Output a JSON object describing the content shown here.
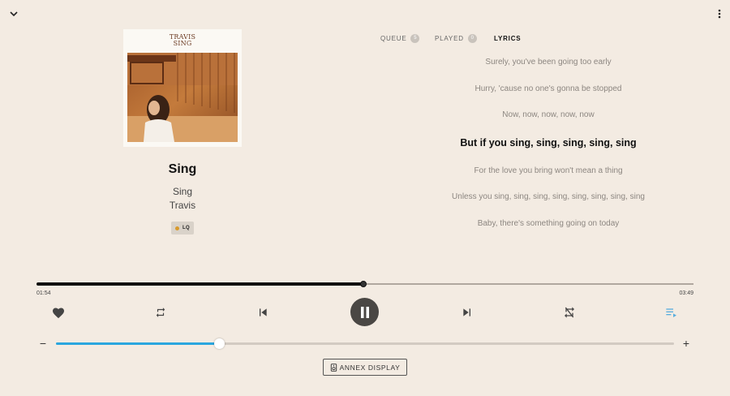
{
  "player": {
    "song_title": "Sing",
    "album": "Sing",
    "artist": "Travis",
    "quality": "LQ",
    "album_art_text": "TRAVIS\nSING"
  },
  "tabs": [
    {
      "label": "QUEUE",
      "count": "5"
    },
    {
      "label": "PLAYED",
      "count": "0"
    },
    {
      "label": "LYRICS"
    }
  ],
  "lyrics": {
    "lines": [
      "Surely, you've been going too early",
      "Hurry, 'cause no one's gonna be stopped",
      "Now, now, now, now, now",
      "But if you sing, sing, sing, sing, sing",
      "For the love you bring won't mean a thing",
      "Unless you sing, sing, sing, sing, sing, sing, sing, sing",
      "Baby, there's something going on today"
    ],
    "current_index": 3
  },
  "progress": {
    "elapsed": "01:54",
    "total": "03:49",
    "fraction": 0.497
  },
  "volume": {
    "fraction": 0.264,
    "down_symbol": "−",
    "up_symbol": "+"
  },
  "controls": {
    "favorite_icon": "heart-icon",
    "repeat_icon": "repeat-icon",
    "previous_icon": "skip-previous-icon",
    "play_pause_icon": "pause-icon",
    "next_icon": "skip-next-icon",
    "shuffle_icon": "shuffle-off-icon",
    "queue_icon": "playlist-play-icon"
  },
  "annex": {
    "label": "ANNEX DISPLAY"
  },
  "colors": {
    "background": "#f3ebe2",
    "accent": "#2aa6de",
    "play_button": "#4a4744",
    "quality_dot": "#d89a2c"
  }
}
